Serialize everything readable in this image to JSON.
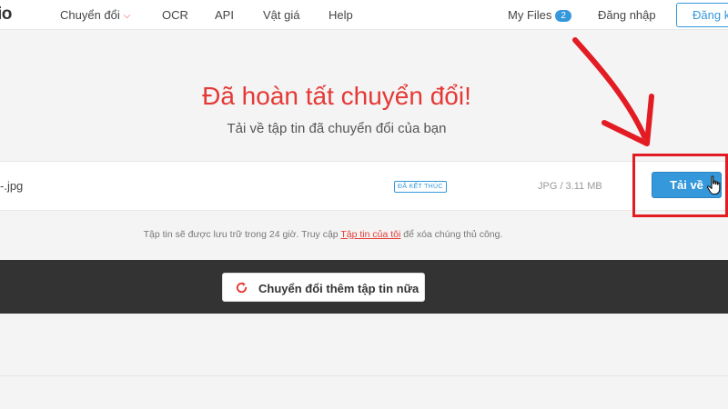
{
  "header": {
    "logo_text": "io",
    "nav": {
      "convert": "Chuyển đổi",
      "ocr": "OCR",
      "api": "API",
      "pricing": "Vật giá",
      "help": "Help"
    },
    "my_files_label": "My Files",
    "my_files_count": "2",
    "login": "Đăng nhập",
    "signup": "Đăng ký"
  },
  "hero": {
    "title": "Đã hoàn tất chuyển đổi!",
    "subtitle": "Tải về tập tin đã chuyển đổi của bạn"
  },
  "file": {
    "name": "-.jpg",
    "status": "ĐÃ KẾT THÚC",
    "meta": "JPG / 3.11 MB",
    "download_label": "Tải về"
  },
  "note": {
    "before": "Tập tin sẽ được lưu trữ trong 24 giờ. Truy cập ",
    "link": "Tập tin của tôi",
    "after": " để xóa chúng thủ công."
  },
  "actions": {
    "convert_more": "Chuyển đổi thêm tập tin nữa"
  },
  "colors": {
    "accent_red": "#e53935",
    "primary_blue": "#3598db",
    "annotation_red": "#e31b23",
    "band_dark": "#333333"
  },
  "icons": [
    "chevron-down-icon",
    "refresh-icon",
    "hand-cursor-icon",
    "annotation-arrow"
  ]
}
